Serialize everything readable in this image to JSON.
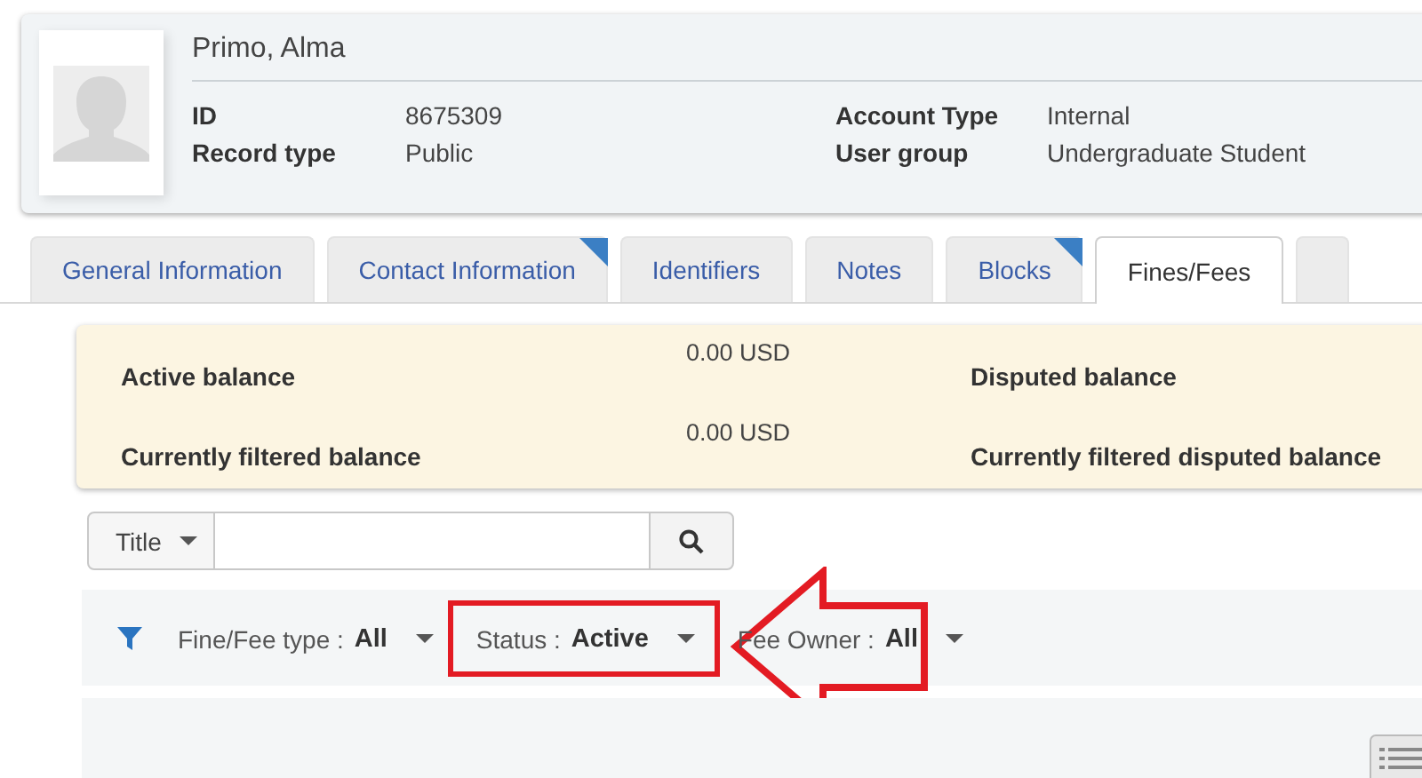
{
  "user": {
    "name": "Primo, Alma",
    "fields": [
      {
        "label": "ID",
        "value": "8675309"
      },
      {
        "label": "Record type",
        "value": "Public"
      },
      {
        "label": "Account Type",
        "value": "Internal"
      },
      {
        "label": "User group",
        "value": "Undergraduate Student"
      }
    ]
  },
  "tabs": [
    {
      "label": "General Information",
      "selected": false,
      "flagged": false
    },
    {
      "label": "Contact Information",
      "selected": false,
      "flagged": true
    },
    {
      "label": "Identifiers",
      "selected": false,
      "flagged": false
    },
    {
      "label": "Notes",
      "selected": false,
      "flagged": false
    },
    {
      "label": "Blocks",
      "selected": false,
      "flagged": true
    },
    {
      "label": "Fines/Fees",
      "selected": true,
      "flagged": false
    }
  ],
  "balances": [
    {
      "label": "Active balance",
      "value": "0.00 USD"
    },
    {
      "label": "Disputed balance"
    },
    {
      "label": "Currently filtered balance",
      "value": "0.00 USD"
    },
    {
      "label": "Currently filtered disputed balance"
    }
  ],
  "search": {
    "scope": "Title"
  },
  "filters": [
    {
      "label": "Fine/Fee type :",
      "value": "All",
      "highlighted": false
    },
    {
      "label": "Status :",
      "value": "Active",
      "highlighted": true
    },
    {
      "label": "Fee Owner :",
      "value": "All",
      "highlighted": false
    }
  ]
}
